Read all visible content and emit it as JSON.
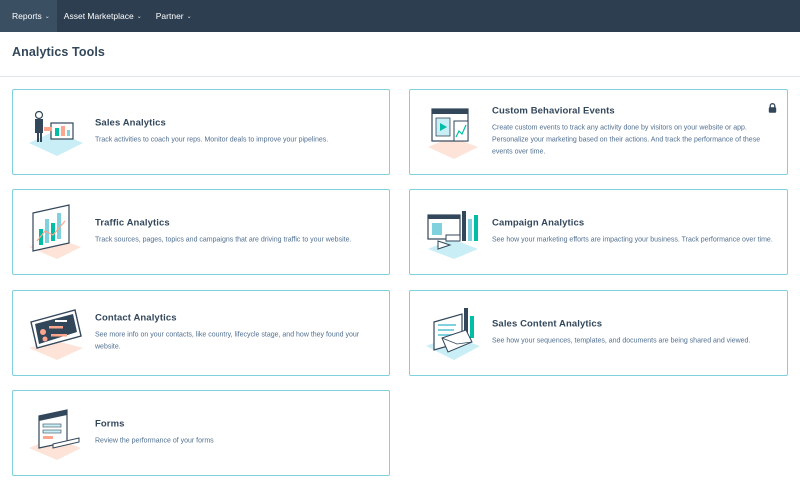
{
  "nav": {
    "items": [
      {
        "label": "Reports"
      },
      {
        "label": "Asset Marketplace"
      },
      {
        "label": "Partner"
      }
    ]
  },
  "page": {
    "title": "Analytics Tools"
  },
  "cards": {
    "sales": {
      "title": "Sales Analytics",
      "description": "Track activities to coach your reps. Monitor deals to improve your pipelines.",
      "icon": "sales-analytics-illustration"
    },
    "custom_events": {
      "title": "Custom Behavioral Events",
      "description": "Create custom events to track any activity done by visitors on your website or app. Personalize your marketing based on their actions. And track the performance of these events over time.",
      "icon": "custom-events-illustration",
      "locked": true
    },
    "traffic": {
      "title": "Traffic Analytics",
      "description": "Track sources, pages, topics and campaigns that are driving traffic to your website.",
      "icon": "traffic-analytics-illustration"
    },
    "campaign": {
      "title": "Campaign Analytics",
      "description": "See how your marketing efforts are impacting your business. Track performance over time.",
      "icon": "campaign-analytics-illustration"
    },
    "contact": {
      "title": "Contact Analytics",
      "description": "See more info on your contacts, like country, lifecycle stage, and how they found your website.",
      "icon": "contact-analytics-illustration"
    },
    "sales_content": {
      "title": "Sales Content Analytics",
      "description": "See how your sequences, templates, and documents are being shared and viewed.",
      "icon": "sales-content-illustration"
    },
    "forms": {
      "title": "Forms",
      "description": "Review the performance of your forms",
      "icon": "forms-illustration"
    }
  },
  "colors": {
    "nav_bg": "#2d3e50",
    "card_border": "#7fd1de",
    "text": "#33475b",
    "muted": "#516f90",
    "teal": "#00bda5",
    "orange": "#fea58e",
    "light_blue": "#c9eef5"
  }
}
